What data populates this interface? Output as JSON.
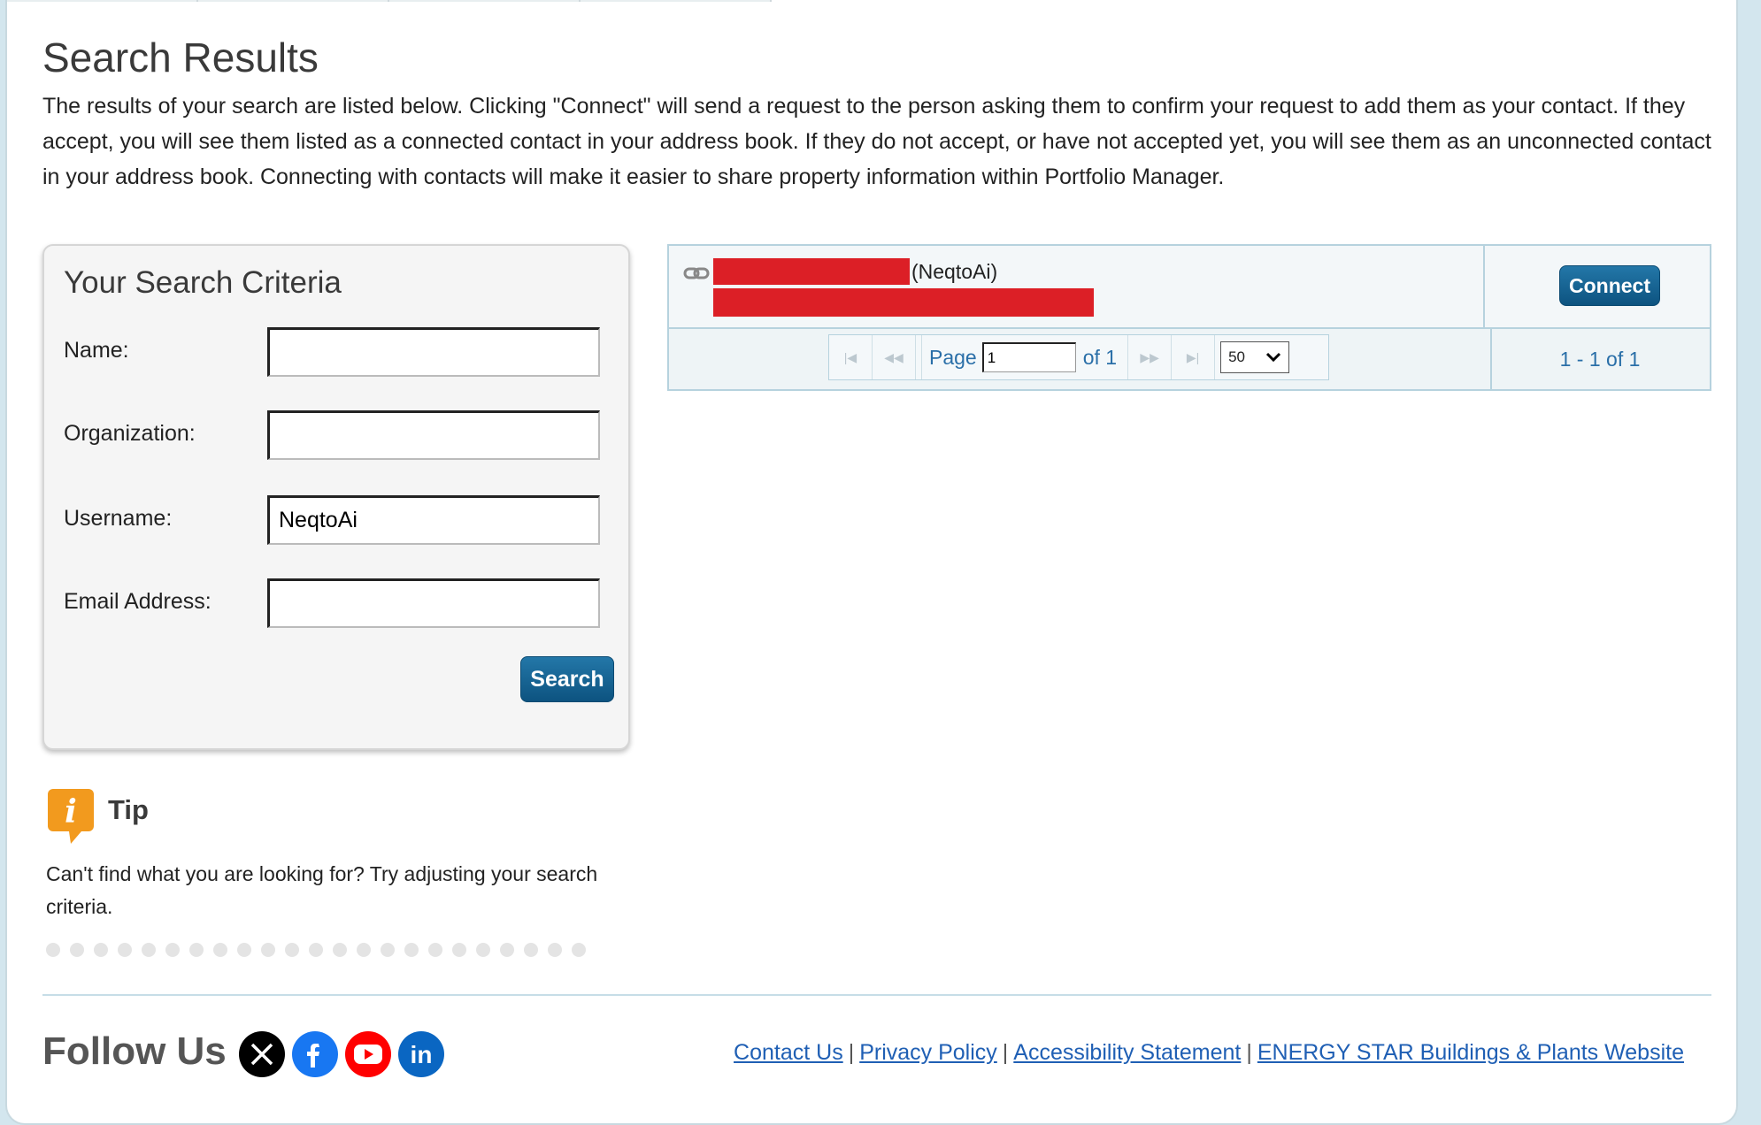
{
  "page": {
    "title": "Search Results",
    "intro": "The results of your search are listed below. Clicking \"Connect\" will send a request to the person asking them to confirm your request to add them as your contact. If they accept, you will see them listed as a connected contact in your address book. If they do not accept, or have not accepted yet, you will see them as an unconnected contact in your address book. Connecting with contacts will make it easier to share property information within Portfolio Manager."
  },
  "criteria": {
    "heading": "Your Search Criteria",
    "fields": [
      {
        "label": "Name:",
        "value": ""
      },
      {
        "label": "Organization:",
        "value": ""
      },
      {
        "label": "Username:",
        "value": "NeqtoAi"
      },
      {
        "label": "Email Address:",
        "value": ""
      }
    ],
    "search_button": "Search"
  },
  "tip": {
    "title": "Tip",
    "text": "Can't find what you are looking for? Try adjusting your search criteria.",
    "icon": "info-icon",
    "icon_color": "#f29a1e"
  },
  "results": {
    "rows": [
      {
        "username": "(NeqtoAi)",
        "connect_label": "Connect",
        "icon": "link-icon"
      }
    ],
    "pager": {
      "page_label": "Page",
      "page_value": "1",
      "of_label": "of 1",
      "per_page": "50",
      "count_label": "1 - 1 of 1"
    }
  },
  "footer": {
    "follow_label": "Follow Us",
    "social": [
      {
        "name": "x-icon",
        "color": "#000000"
      },
      {
        "name": "facebook-icon",
        "color": "#1877f2"
      },
      {
        "name": "youtube-icon",
        "color": "#ff0000"
      },
      {
        "name": "linkedin-icon",
        "color": "#0a66c2"
      }
    ],
    "links": [
      "Contact Us",
      "Privacy Policy",
      "Accessibility Statement",
      "ENERGY STAR Buildings & Plants Website"
    ]
  },
  "colors": {
    "accent_button": "#1a6a9c",
    "link": "#1f5fb4",
    "redaction": "#dc1f26"
  }
}
